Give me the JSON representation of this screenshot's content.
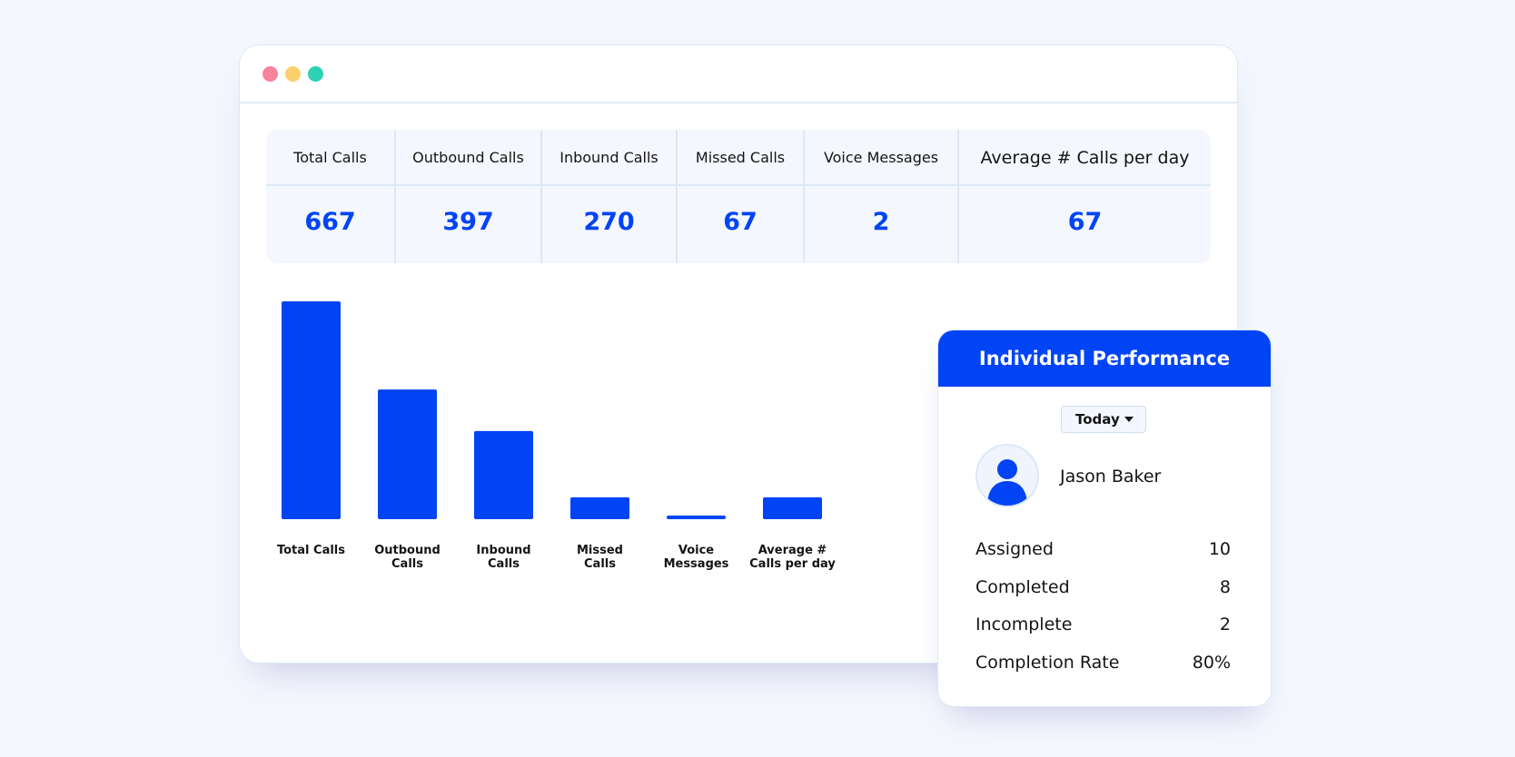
{
  "window": {
    "controls": [
      {
        "name": "close-dot",
        "color": "#f7839c"
      },
      {
        "name": "minimize-dot",
        "color": "#fdd06e"
      },
      {
        "name": "maximize-dot",
        "color": "#2fd1b5"
      }
    ]
  },
  "stats": [
    {
      "label": "Total Calls",
      "value": "667"
    },
    {
      "label": "Outbound Calls",
      "value": "397"
    },
    {
      "label": "Inbound Calls",
      "value": "270"
    },
    {
      "label": "Missed Calls",
      "value": "67"
    },
    {
      "label": "Voice Messages",
      "value": "2"
    },
    {
      "label": "Average # Calls per day",
      "value": "67"
    }
  ],
  "chart_data": {
    "type": "bar",
    "categories": [
      "Total Calls",
      "Outbound Calls",
      "Inbound Calls",
      "Missed Calls",
      "Voice Messages",
      "Average # Calls per day"
    ],
    "category_lines": [
      [
        "Total Calls"
      ],
      [
        "Outbound",
        "Calls"
      ],
      [
        "Inbound",
        "Calls"
      ],
      [
        "Missed",
        "Calls"
      ],
      [
        "Voice",
        "Messages"
      ],
      [
        "Average #",
        "Calls per day"
      ]
    ],
    "values": [
      667,
      397,
      270,
      67,
      2,
      67
    ],
    "ylim": [
      0,
      667
    ],
    "grid": false,
    "bar_color": "#0044f5"
  },
  "card": {
    "title": "Individual Performance",
    "dropdown": {
      "selected": "Today"
    },
    "person": {
      "name": "Jason Baker"
    },
    "metrics": [
      {
        "label": "Assigned",
        "value": "10"
      },
      {
        "label": "Completed",
        "value": "8"
      },
      {
        "label": "Incomplete",
        "value": "2"
      },
      {
        "label": "Completion Rate",
        "value": "80%"
      }
    ]
  },
  "colors": {
    "accent": "#0044f5",
    "page_background": "#f4f7fd"
  }
}
